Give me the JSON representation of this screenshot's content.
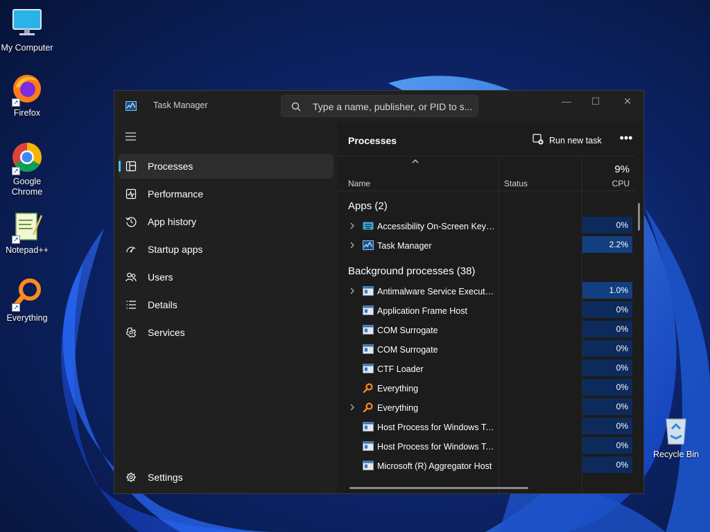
{
  "desktop": {
    "icons": [
      {
        "label": "My Computer",
        "icon": "monitor-icon"
      },
      {
        "label": "Firefox",
        "icon": "firefox-icon"
      },
      {
        "label": "Google Chrome",
        "icon": "chrome-icon"
      },
      {
        "label": "Notepad++",
        "icon": "notepadpp-icon"
      },
      {
        "label": "Everything",
        "icon": "everything-icon"
      },
      {
        "label": "Recycle Bin",
        "icon": "recycle-bin-icon"
      }
    ]
  },
  "window": {
    "title": "Task Manager",
    "search_placeholder": "Type a name, publisher, or PID to s...",
    "controls": {
      "minimize": "—",
      "maximize": "☐",
      "close": "✕"
    }
  },
  "sidebar": {
    "items": [
      {
        "label": "Processes",
        "icon": "processes-icon",
        "active": true
      },
      {
        "label": "Performance",
        "icon": "performance-icon"
      },
      {
        "label": "App history",
        "icon": "app-history-icon"
      },
      {
        "label": "Startup apps",
        "icon": "startup-apps-icon"
      },
      {
        "label": "Users",
        "icon": "users-icon"
      },
      {
        "label": "Details",
        "icon": "details-icon"
      },
      {
        "label": "Services",
        "icon": "services-icon"
      }
    ],
    "settings_label": "Settings"
  },
  "content": {
    "title": "Processes",
    "run_new_task_label": "Run new task",
    "more_label": "•••",
    "columns": {
      "name": "Name",
      "status": "Status",
      "cpu": "CPU",
      "cpu_total": "9%"
    },
    "groups": [
      {
        "label": "Apps (2)"
      },
      {
        "label": "Background processes (38)"
      }
    ],
    "apps": [
      {
        "name": "Accessibility On-Screen Keyboard",
        "cpu": "0%",
        "expandable": true,
        "icon": "keyboard-icon"
      },
      {
        "name": "Task Manager",
        "cpu": "2.2%",
        "expandable": true,
        "icon": "task-manager-icon"
      }
    ],
    "background": [
      {
        "name": "Antimalware Service Executable",
        "cpu": "1.0%",
        "expandable": true,
        "icon": "process-icon"
      },
      {
        "name": "Application Frame Host",
        "cpu": "0%",
        "expandable": false,
        "icon": "process-icon"
      },
      {
        "name": "COM Surrogate",
        "cpu": "0%",
        "expandable": false,
        "icon": "process-icon"
      },
      {
        "name": "COM Surrogate",
        "cpu": "0%",
        "expandable": false,
        "icon": "process-icon"
      },
      {
        "name": "CTF Loader",
        "cpu": "0%",
        "expandable": false,
        "icon": "process-icon"
      },
      {
        "name": "Everything",
        "cpu": "0%",
        "expandable": false,
        "icon": "everything-icon"
      },
      {
        "name": "Everything",
        "cpu": "0%",
        "expandable": true,
        "icon": "everything-icon"
      },
      {
        "name": "Host Process for Windows Tasks",
        "cpu": "0%",
        "expandable": false,
        "icon": "process-icon"
      },
      {
        "name": "Host Process for Windows Tasks",
        "cpu": "0%",
        "expandable": false,
        "icon": "process-icon"
      },
      {
        "name": "Microsoft (R) Aggregator Host",
        "cpu": "0%",
        "expandable": false,
        "icon": "process-icon"
      }
    ]
  }
}
